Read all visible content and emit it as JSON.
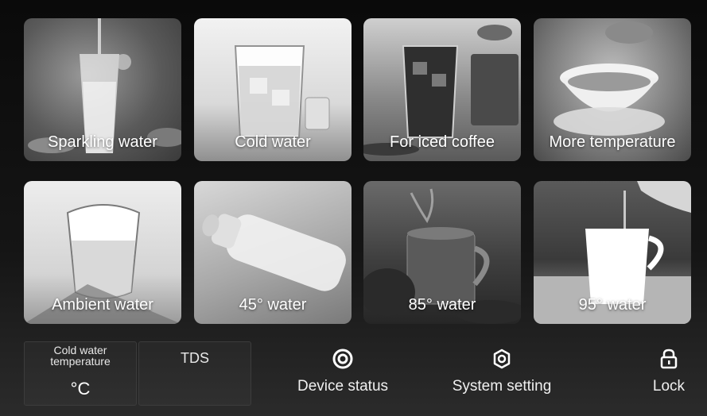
{
  "tiles": [
    {
      "label": "Sparkling water"
    },
    {
      "label": "Cold water"
    },
    {
      "label": "For iced coffee"
    },
    {
      "label": "More temperature"
    },
    {
      "label": "Ambient water"
    },
    {
      "label": "45° water"
    },
    {
      "label": "85° water"
    },
    {
      "label": "95° water"
    }
  ],
  "status": {
    "cold_water_title": "Cold water temperature",
    "cold_water_unit": "°C",
    "tds_title": "TDS"
  },
  "actions": {
    "device_status": "Device status",
    "system_setting": "System setting",
    "lock": "Lock"
  },
  "icons": {
    "device_status": "target-icon",
    "system_setting": "gear-icon",
    "lock": "lock-icon"
  },
  "colors": {
    "background": "#1a1a1a",
    "text": "#ffffff"
  }
}
